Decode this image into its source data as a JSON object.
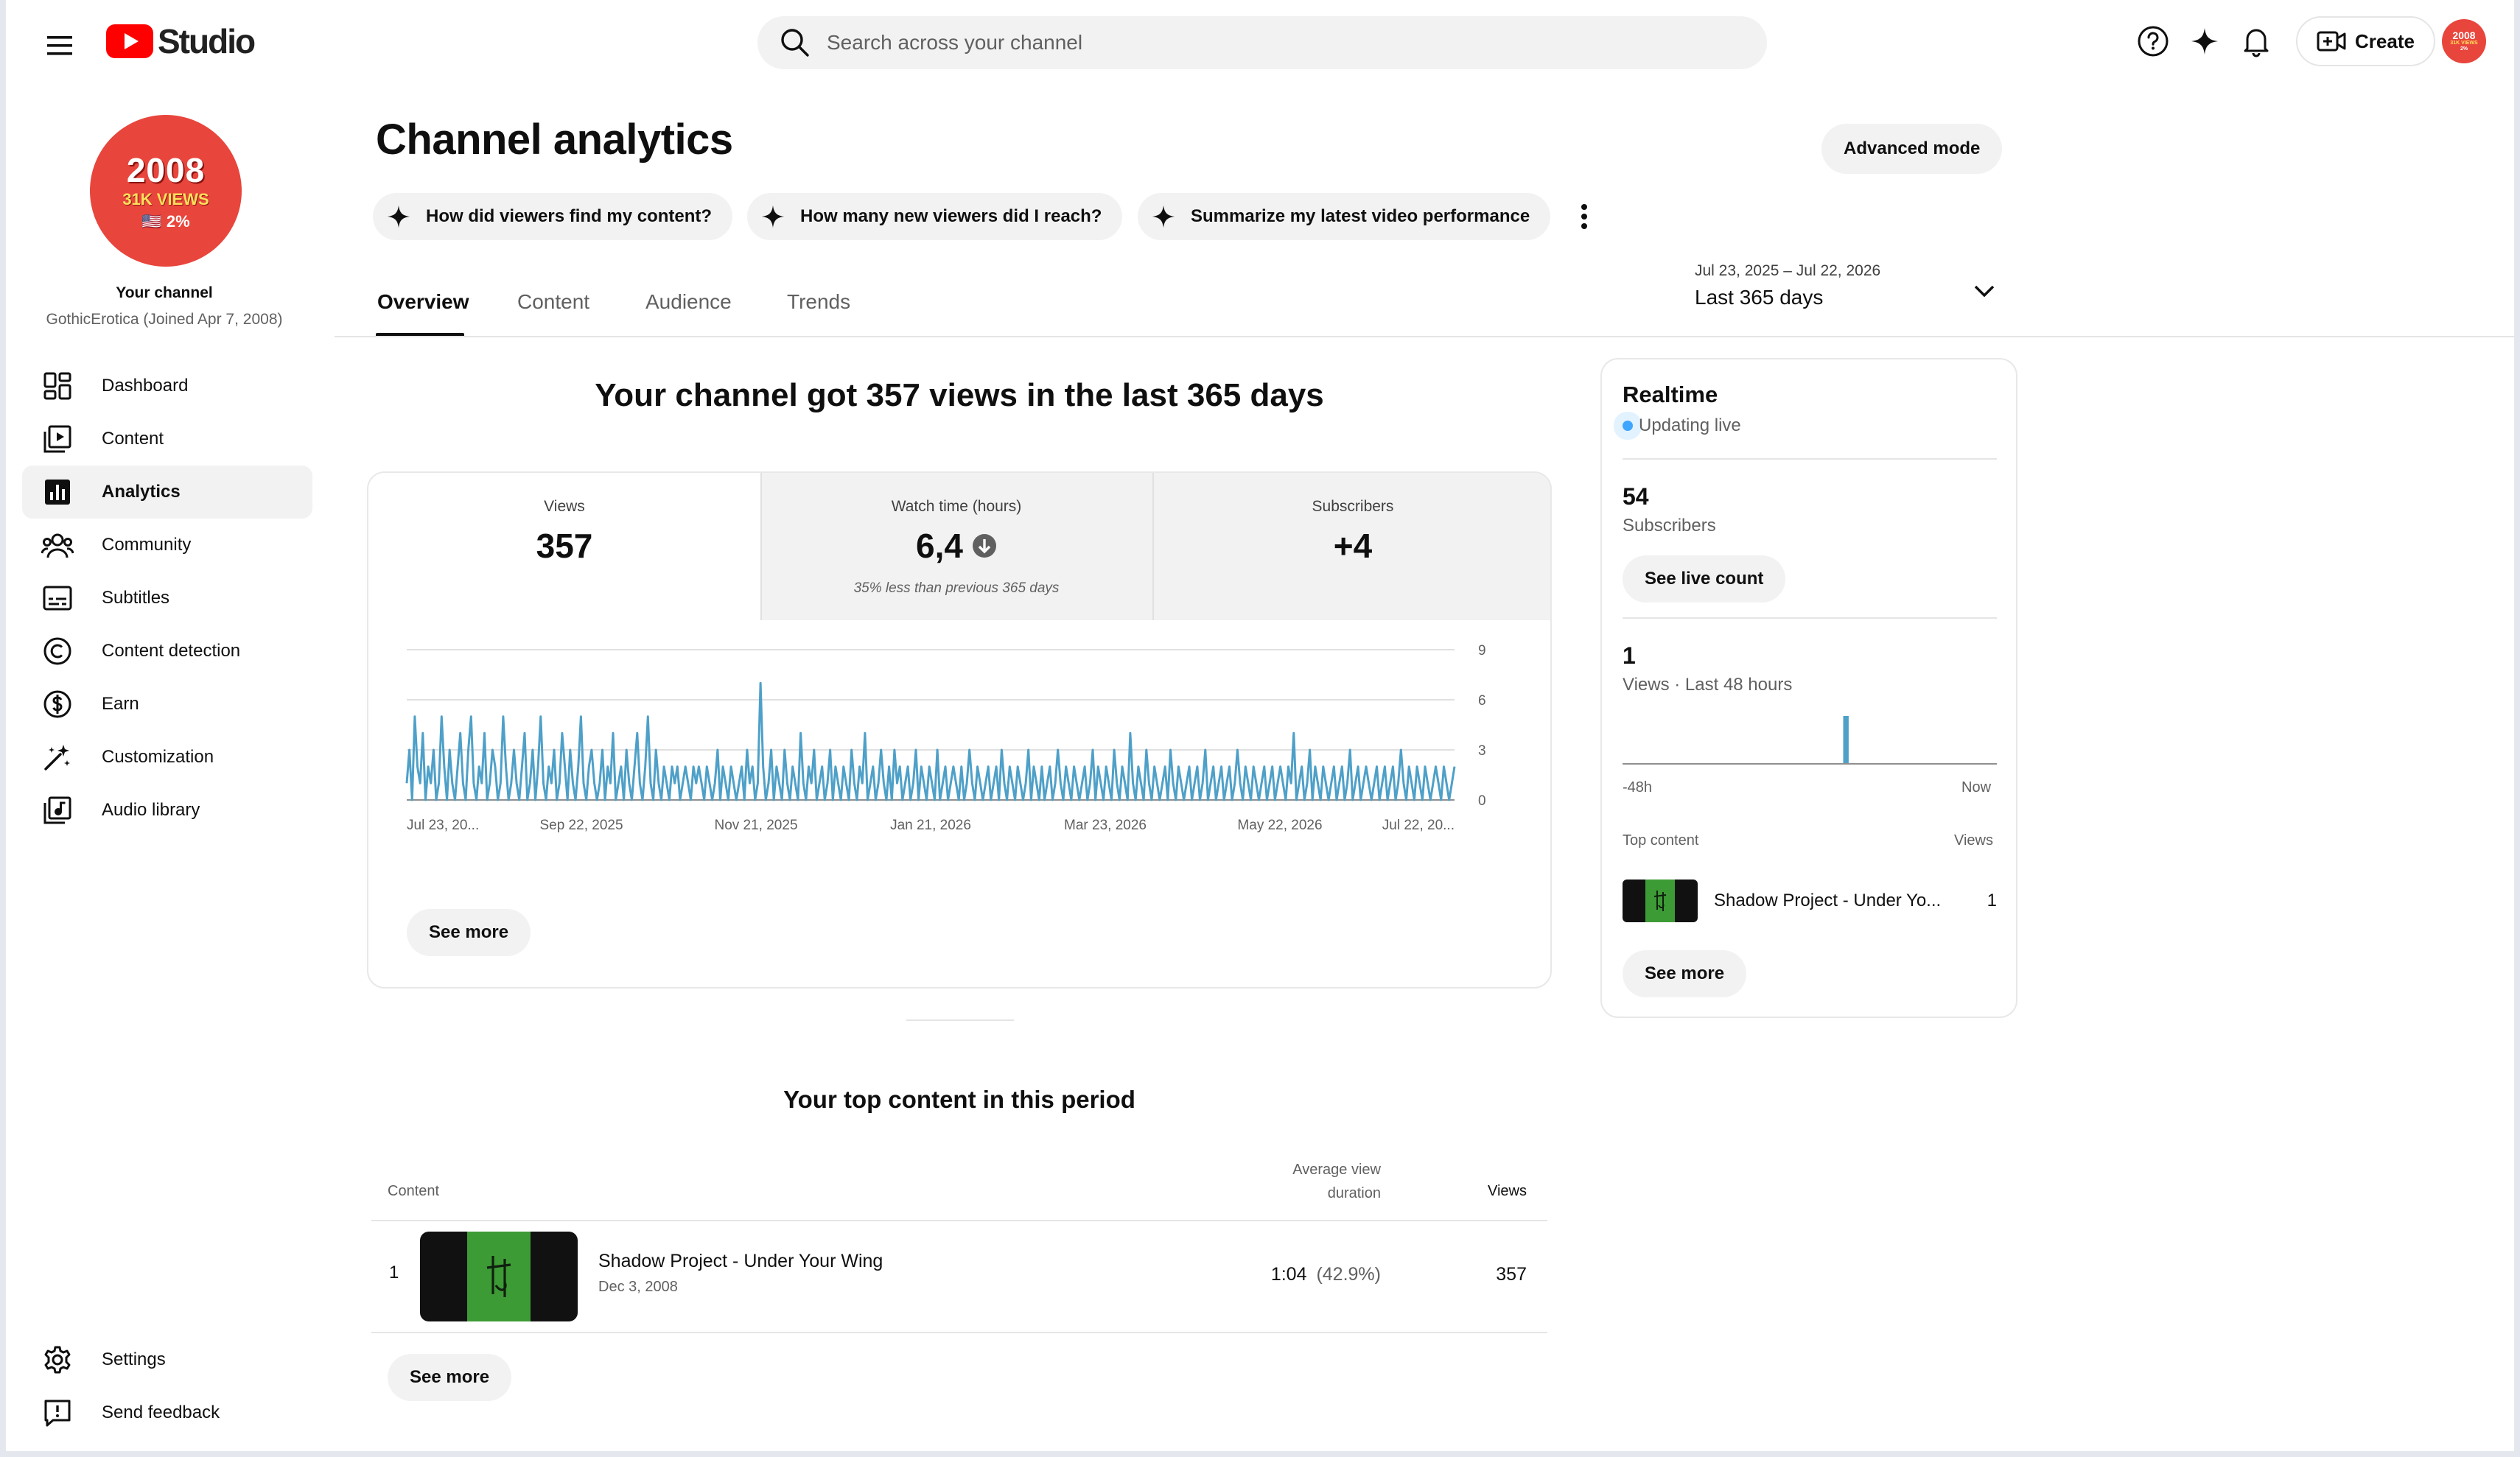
{
  "app": {
    "title": "Studio",
    "search_placeholder": "Search across your channel",
    "create_label": "Create",
    "avatar_text": [
      "2008",
      "31K VIEWS",
      "2%"
    ]
  },
  "sidebar": {
    "channel_badge": {
      "year": "2008",
      "views": "31K VIEWS",
      "flag": "🇺🇸 2%"
    },
    "your_channel": "Your channel",
    "channel_meta": "GothicErotica (Joined Apr 7, 2008)",
    "items": [
      {
        "label": "Dashboard",
        "icon": "dashboard-icon"
      },
      {
        "label": "Content",
        "icon": "content-icon"
      },
      {
        "label": "Analytics",
        "icon": "analytics-icon",
        "active": true
      },
      {
        "label": "Community",
        "icon": "community-icon"
      },
      {
        "label": "Subtitles",
        "icon": "subtitles-icon"
      },
      {
        "label": "Content detection",
        "icon": "copyright-icon"
      },
      {
        "label": "Earn",
        "icon": "dollar-icon"
      },
      {
        "label": "Customization",
        "icon": "magic-wand-icon"
      },
      {
        "label": "Audio library",
        "icon": "audio-library-icon"
      }
    ],
    "bottom_items": [
      {
        "label": "Settings",
        "icon": "gear-icon"
      },
      {
        "label": "Send feedback",
        "icon": "feedback-icon"
      }
    ]
  },
  "header": {
    "title": "Channel analytics",
    "advanced_mode": "Advanced mode",
    "chips": [
      "How did viewers find my content?",
      "How many new viewers did I reach?",
      "Summarize my latest video performance"
    ],
    "date_range": "Jul 23, 2025 – Jul 22, 2026",
    "date_preset": "Last 365 days",
    "tabs": [
      "Overview",
      "Content",
      "Audience",
      "Trends"
    ],
    "active_tab": "Overview"
  },
  "overview": {
    "headline": "Your channel got 357 views in the last 365 days",
    "metrics": [
      {
        "label": "Views",
        "value": "357",
        "note": ""
      },
      {
        "label": "Watch time (hours)",
        "value": "6,4",
        "note": "35% less than previous 365 days",
        "trend": "down"
      },
      {
        "label": "Subscribers",
        "value": "+4",
        "note": ""
      }
    ],
    "see_more": "See more"
  },
  "chart_data": {
    "type": "line",
    "x_tick_labels": [
      "Jul 23, 20...",
      "Sep 22, 2025",
      "Nov 21, 2025",
      "Jan 21, 2026",
      "Mar 23, 2026",
      "May 22, 2026",
      "Jul 22, 20..."
    ],
    "y_ticks": [
      0,
      3,
      6,
      9
    ],
    "ylim": [
      0,
      9
    ],
    "grid": true,
    "color": "#4ea0c8",
    "series": [
      {
        "values": [
          1,
          3,
          0,
          5,
          2,
          1,
          4,
          0,
          2,
          1,
          3,
          0,
          1,
          5,
          2,
          0,
          3,
          1,
          0,
          2,
          4,
          1,
          0,
          3,
          5,
          1,
          0,
          2,
          1,
          4,
          0,
          1,
          3,
          2,
          0,
          1,
          5,
          2,
          0,
          1,
          3,
          1,
          0,
          2,
          4,
          0,
          1,
          3,
          0,
          2,
          5,
          1,
          0,
          2,
          1,
          3,
          0,
          1,
          4,
          2,
          0,
          3,
          1,
          0,
          2,
          5,
          1,
          0,
          2,
          3,
          1,
          0,
          1,
          3,
          0,
          2,
          1,
          4,
          0,
          1,
          2,
          0,
          3,
          1,
          0,
          2,
          4,
          1,
          0,
          2,
          5,
          1,
          0,
          3,
          1,
          0,
          2,
          1,
          0,
          2,
          1,
          2,
          0,
          1,
          2,
          1,
          0,
          2,
          1,
          2,
          1,
          0,
          2,
          1,
          0,
          1,
          3,
          0,
          2,
          1,
          0,
          2,
          1,
          0,
          1,
          2,
          0,
          3,
          1,
          2,
          0,
          1,
          7,
          2,
          0,
          1,
          3,
          0,
          2,
          1,
          0,
          3,
          1,
          0,
          2,
          1,
          0,
          4,
          1,
          0,
          2,
          1,
          3,
          0,
          1,
          2,
          0,
          1,
          3,
          0,
          2,
          1,
          0,
          2,
          1,
          0,
          3,
          1,
          0,
          2,
          1,
          4,
          0,
          1,
          2,
          0,
          1,
          3,
          1,
          0,
          2,
          0,
          3,
          1,
          2,
          0,
          1,
          2,
          0,
          1,
          3,
          0,
          2,
          1,
          0,
          2,
          1,
          0,
          3,
          0,
          1,
          2,
          0,
          1,
          2,
          1,
          0,
          2,
          0,
          1,
          3,
          1,
          0,
          2,
          1,
          0,
          1,
          2,
          0,
          1,
          2,
          0,
          3,
          1,
          0,
          2,
          1,
          0,
          2,
          1,
          0,
          1,
          3,
          0,
          2,
          1,
          0,
          2,
          0,
          1,
          2,
          0,
          1,
          3,
          1,
          0,
          2,
          1,
          0,
          2,
          1,
          0,
          1,
          2,
          0,
          1,
          3,
          0,
          2,
          1,
          0,
          2,
          1,
          0,
          3,
          1,
          0,
          2,
          1,
          0,
          4,
          1,
          0,
          2,
          1,
          0,
          3,
          1,
          0,
          2,
          1,
          0,
          1,
          2,
          0,
          3,
          1,
          0,
          2,
          1,
          0,
          1,
          2,
          0,
          1,
          2,
          0,
          1,
          3,
          0,
          1,
          2,
          0,
          1,
          2,
          0,
          1,
          2,
          0,
          1,
          3,
          1,
          0,
          2,
          1,
          0,
          2,
          1,
          0,
          1,
          2,
          0,
          1,
          2,
          0,
          1,
          2,
          1,
          0,
          2,
          1,
          4,
          0,
          1,
          2,
          0,
          1,
          3,
          0,
          2,
          1,
          0,
          2,
          1,
          0,
          1,
          2,
          0,
          1,
          2,
          0,
          1,
          3,
          0,
          1,
          2,
          0,
          1,
          2,
          1,
          0,
          1,
          2,
          0,
          1,
          2,
          0,
          1,
          2,
          0,
          1,
          3,
          1,
          0,
          2,
          1,
          0,
          2,
          1,
          0,
          2,
          1,
          0,
          1,
          2,
          1,
          0,
          2,
          1,
          0,
          1,
          2
        ]
      }
    ]
  },
  "realtime": {
    "title": "Realtime",
    "status": "Updating live",
    "subscribers_value": "54",
    "subscribers_label": "Subscribers",
    "see_live_count": "See live count",
    "views_value": "1",
    "views_label": "Views · Last 48 hours",
    "axis_start": "-48h",
    "axis_end": "Now",
    "bar_values_48h": [
      0,
      0,
      0,
      0,
      0,
      0,
      0,
      0,
      0,
      0,
      0,
      0,
      0,
      0,
      0,
      0,
      0,
      0,
      0,
      0,
      0,
      0,
      0,
      0,
      0,
      0,
      0,
      0,
      1,
      0,
      0,
      0,
      0,
      0,
      0,
      0,
      0,
      0,
      0,
      0,
      0,
      0,
      0,
      0,
      0,
      0,
      0,
      0
    ],
    "top_content_label": "Top content",
    "views_header": "Views",
    "top_item_title": "Shadow Project - Under Yo...",
    "top_item_views": "1",
    "see_more": "See more"
  },
  "top_content": {
    "title": "Your top content in this period",
    "col_content": "Content",
    "col_avd": "Average view duration",
    "col_views": "Views",
    "rows": [
      {
        "rank": "1",
        "title": "Shadow Project - Under Your Wing",
        "date": "Dec 3, 2008",
        "avd": "1:04",
        "avd_pct": "(42.9%)",
        "views": "357"
      }
    ],
    "see_more": "See more"
  }
}
